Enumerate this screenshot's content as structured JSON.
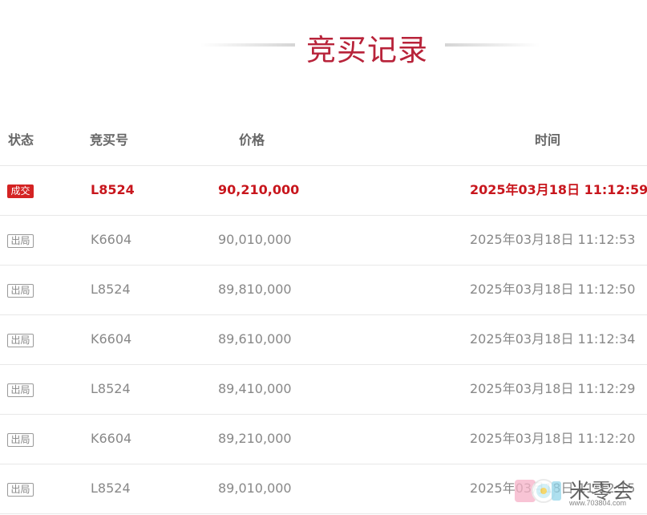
{
  "title": "竞买记录",
  "columns": {
    "status": "状态",
    "bid_no": "竞买号",
    "price": "价格",
    "time": "时间"
  },
  "rows": [
    {
      "status": "成交",
      "bid_no": "L8524",
      "price": "90,210,000",
      "time": "2025年03月18日 11:12:59"
    },
    {
      "status": "出局",
      "bid_no": "K6604",
      "price": "90,010,000",
      "time": "2025年03月18日 11:12:53"
    },
    {
      "status": "出局",
      "bid_no": "L8524",
      "price": "89,810,000",
      "time": "2025年03月18日 11:12:50"
    },
    {
      "status": "出局",
      "bid_no": "K6604",
      "price": "89,610,000",
      "time": "2025年03月18日 11:12:34"
    },
    {
      "status": "出局",
      "bid_no": "L8524",
      "price": "89,410,000",
      "time": "2025年03月18日 11:12:29"
    },
    {
      "status": "出局",
      "bid_no": "K6604",
      "price": "89,210,000",
      "time": "2025年03月18日 11:12:20"
    },
    {
      "status": "出局",
      "bid_no": "L8524",
      "price": "89,010,000",
      "time": "2025年03月18日 11:12:15"
    }
  ],
  "watermark": {
    "text": "米零会",
    "sub": "www.703804.com"
  },
  "colors": {
    "accent": "#b8233a",
    "win": "#c8161d",
    "muted": "#888888"
  }
}
